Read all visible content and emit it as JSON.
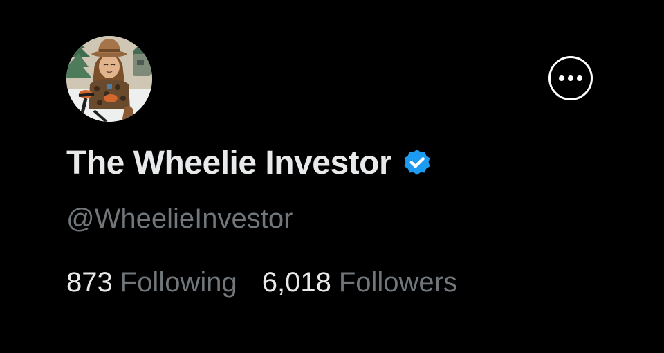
{
  "profile": {
    "avatar_icon": "avatar-cowboy-illustration",
    "display_name": "The Wheelie Investor",
    "verified_icon": "verified-badge-icon",
    "handle": "@WheelieInvestor"
  },
  "actions": {
    "more_icon": "more-options-icon"
  },
  "stats": {
    "following_count": "873",
    "following_label": "Following",
    "followers_count": "6,018",
    "followers_label": "Followers"
  },
  "colors": {
    "background": "#000000",
    "primary_text": "#e7e9ea",
    "secondary_text": "#71767b",
    "verified_blue": "#1d9bf0",
    "button_border": "#ffffff"
  }
}
